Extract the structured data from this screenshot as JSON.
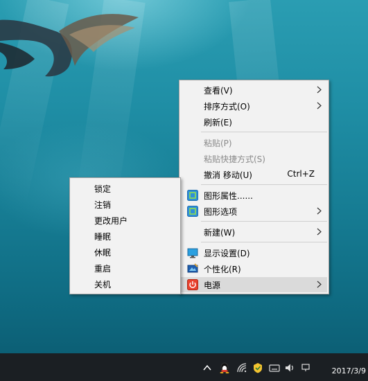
{
  "main_menu": {
    "items": [
      {
        "label": "查看(V)"
      },
      {
        "label": "排序方式(O)"
      },
      {
        "label": "刷新(E)"
      },
      {
        "label": "粘贴(P)"
      },
      {
        "label": "粘贴快捷方式(S)"
      },
      {
        "label": "撤消 移动(U)",
        "shortcut": "Ctrl+Z"
      },
      {
        "label": "图形属性......"
      },
      {
        "label": "图形选项"
      },
      {
        "label": "新建(W)"
      },
      {
        "label": "显示设置(D)"
      },
      {
        "label": "个性化(R)"
      },
      {
        "label": "电源"
      }
    ]
  },
  "power_submenu": {
    "items": [
      {
        "label": "锁定"
      },
      {
        "label": "注销"
      },
      {
        "label": "更改用户"
      },
      {
        "label": "睡眠"
      },
      {
        "label": "休眠"
      },
      {
        "label": "重启"
      },
      {
        "label": "关机"
      }
    ]
  },
  "taskbar": {
    "clock_date": "2017/3/9"
  },
  "icons": {
    "graphics_properties": "intel-graphics-icon",
    "graphics_options": "intel-graphics-icon",
    "display_settings": "monitor-icon",
    "personalize": "personalize-icon",
    "power": "power-icon"
  },
  "colors": {
    "menu_bg": "#f2f2f2",
    "menu_highlight": "#dadada",
    "disabled_text": "#8a8a8a",
    "taskbar_bg": "#1b1f23",
    "desktop_water": "#1f8ea5"
  }
}
